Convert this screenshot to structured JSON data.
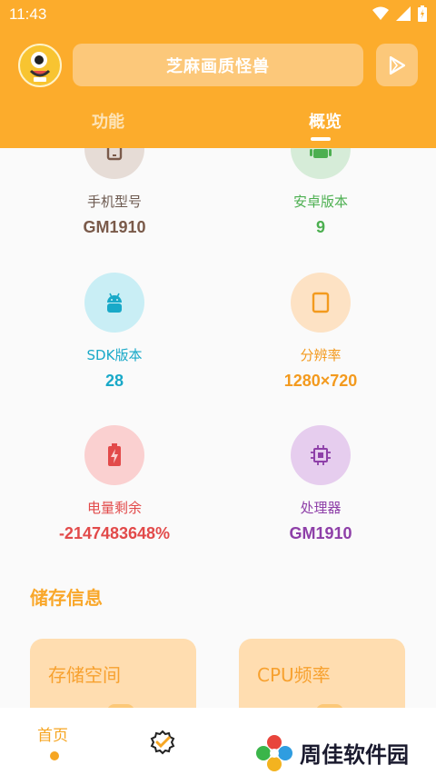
{
  "status_bar": {
    "time": "11:43"
  },
  "header": {
    "app_title": "芝麻画质怪兽",
    "tabs": [
      {
        "label": "功能"
      },
      {
        "label": "概览"
      }
    ]
  },
  "overview": {
    "items": [
      {
        "label": "手机型号",
        "value": "GM1910",
        "icon": "phone-icon",
        "color": "#7a5a4a",
        "bg": "#e6dcd6"
      },
      {
        "label": "安卓版本",
        "value": "9",
        "icon": "android-icon",
        "color": "#4caf50",
        "bg": "#d6ecd8"
      },
      {
        "label": "SDK版本",
        "value": "28",
        "icon": "android-icon",
        "color": "#19a9c8",
        "bg": "#c9eef5"
      },
      {
        "label": "分辨率",
        "value": "1280×720",
        "icon": "tablet-icon",
        "color": "#f39a1e",
        "bg": "#fde2c4"
      },
      {
        "label": "电量剩余",
        "value": "-2147483648%",
        "icon": "battery-charging-icon",
        "color": "#e24a4a",
        "bg": "#fad0d0"
      },
      {
        "label": "处理器",
        "value": "GM1910",
        "icon": "cpu-icon",
        "color": "#8e3fa8",
        "bg": "#e6cdee"
      }
    ]
  },
  "storage": {
    "section_title": "储存信息",
    "cards": [
      {
        "title": "存储空间"
      },
      {
        "title": "CPU频率"
      }
    ]
  },
  "bottom_nav": {
    "home_label": "首页"
  },
  "watermark": {
    "text": "周佳软件园"
  },
  "colors": {
    "accent": "#fcac2c",
    "tab_inactive": "#fde4b8"
  }
}
